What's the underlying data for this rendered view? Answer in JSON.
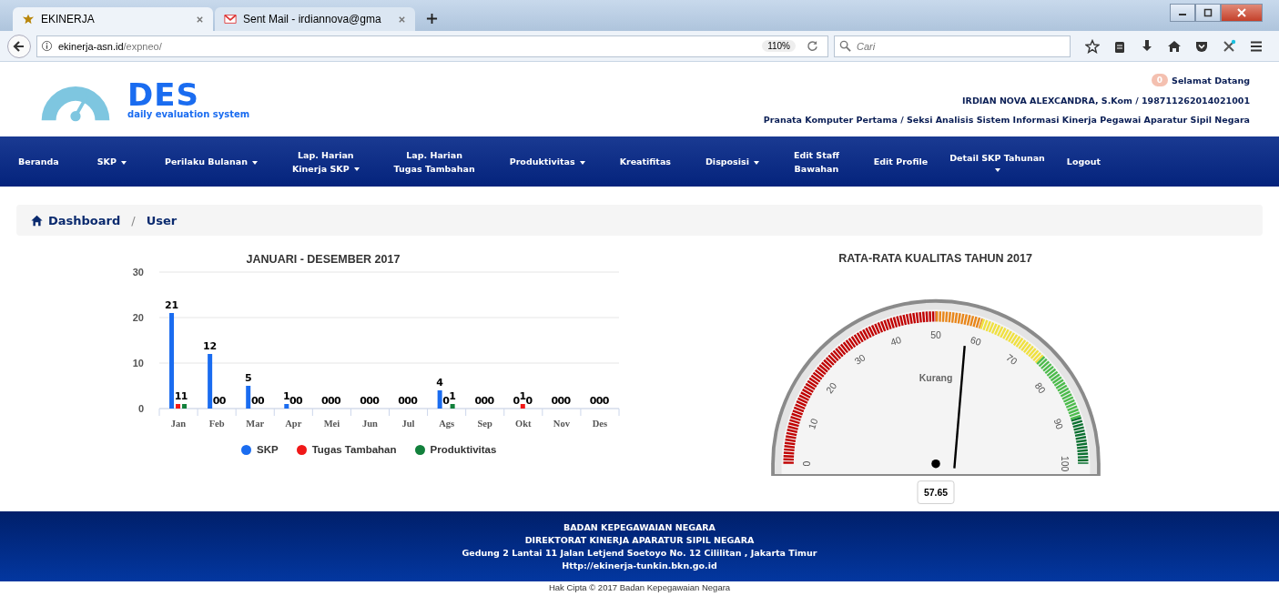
{
  "browser": {
    "tabs": [
      {
        "title": "EKINERJA",
        "selected": true
      },
      {
        "title": "Sent Mail - irdiannova@gma",
        "selected": false
      }
    ],
    "url": {
      "host": "ekinerja-asn.id",
      "path": "/expneo/"
    },
    "zoom": "110%",
    "search": {
      "placeholder": "Cari"
    }
  },
  "header": {
    "logo": {
      "title": "DES",
      "subtitle": "daily evaluation system"
    },
    "notification_count": "0",
    "greeting": "Selamat Datang",
    "user": "IRDIAN NOVA ALEXCANDRA, S.Kom / 198711262014021001",
    "position": "Pranata Komputer Pertama / Seksi Analisis Sistem Informasi Kinerja Pegawai Aparatur Sipil Negara"
  },
  "nav": [
    {
      "lines": [
        "Beranda"
      ],
      "dropdown": false
    },
    {
      "lines": [
        "SKP"
      ],
      "dropdown": true
    },
    {
      "lines": [
        "Perilaku Bulanan"
      ],
      "dropdown": true
    },
    {
      "lines": [
        "Lap. Harian",
        "Kinerja SKP"
      ],
      "dropdown": true
    },
    {
      "lines": [
        "Lap. Harian",
        "Tugas Tambahan"
      ],
      "dropdown": false
    },
    {
      "lines": [
        "Produktivitas"
      ],
      "dropdown": true
    },
    {
      "lines": [
        "Kreatifitas"
      ],
      "dropdown": false
    },
    {
      "lines": [
        "Disposisi"
      ],
      "dropdown": true
    },
    {
      "lines": [
        "Edit Staff",
        "Bawahan"
      ],
      "dropdown": false
    },
    {
      "lines": [
        "Edit Profile"
      ],
      "dropdown": false
    },
    {
      "lines": [
        "Detail SKP Tahunan"
      ],
      "dropdown": true,
      "caret_below": true
    },
    {
      "lines": [
        "Logout"
      ],
      "dropdown": false
    }
  ],
  "breadcrumb": {
    "separator": "/",
    "items": [
      {
        "label": "Dashboard",
        "kind": "home"
      },
      {
        "label": "User",
        "kind": "plain"
      }
    ]
  },
  "bar_panel": {
    "chart_data": {
      "type": "bar",
      "title": "JANUARI - DESEMBER 2017",
      "categories": [
        "Jan",
        "Feb",
        "Mar",
        "Apr",
        "Mei",
        "Jun",
        "Jul",
        "Ags",
        "Sep",
        "Okt",
        "Nov",
        "Des"
      ],
      "series": [
        {
          "name": "SKP",
          "color": "#1a6cf0",
          "values": [
            21,
            12,
            5,
            1,
            0,
            0,
            0,
            4,
            0,
            0,
            0,
            0
          ]
        },
        {
          "name": "Tugas Tambahan",
          "color": "#f01818",
          "values": [
            1,
            0,
            0,
            0,
            0,
            0,
            0,
            0,
            0,
            1,
            0,
            0
          ]
        },
        {
          "name": "Produktivitas",
          "color": "#12803c",
          "values": [
            1,
            0,
            0,
            0,
            0,
            0,
            0,
            1,
            0,
            0,
            0,
            0
          ]
        }
      ],
      "ylim": [
        0,
        30
      ],
      "yticks": [
        0,
        10,
        20,
        30
      ],
      "data_labels": true
    }
  },
  "gauge_panel": {
    "title": "RATA-RATA KUALITAS TAHUN 2017",
    "band_label": "Kurang",
    "value": "57.65",
    "level": 0.5765,
    "ticks": [
      "0",
      "10",
      "20",
      "30",
      "40",
      "50",
      "60",
      "70",
      "80",
      "90",
      "100"
    ]
  },
  "footer": {
    "lines": [
      "BADAN KEPEGAWAIAN NEGARA",
      "DIREKTORAT KINERJA APARATUR SIPIL NEGARA",
      "Gedung 2 Lantai 11 Jalan Letjend Soetoyo No. 12 Cililitan , Jakarta Timur",
      "Http://ekinerja-tunkin.bkn.go.id"
    ],
    "copyright": "Hak Cipta © 2017 Badan Kepegawaian Negara"
  }
}
